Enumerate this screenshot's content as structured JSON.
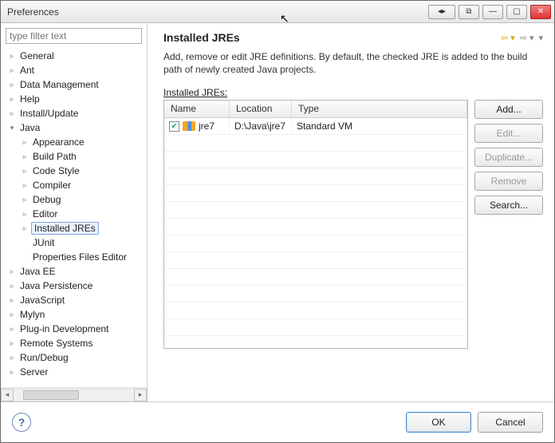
{
  "window": {
    "title": "Preferences"
  },
  "filter": {
    "placeholder": "type filter text"
  },
  "tree": [
    {
      "label": "General",
      "indent": 1,
      "arrow": "right"
    },
    {
      "label": "Ant",
      "indent": 1,
      "arrow": "right"
    },
    {
      "label": "Data Management",
      "indent": 1,
      "arrow": "right"
    },
    {
      "label": "Help",
      "indent": 1,
      "arrow": "right"
    },
    {
      "label": "Install/Update",
      "indent": 1,
      "arrow": "right"
    },
    {
      "label": "Java",
      "indent": 1,
      "arrow": "down",
      "selected": false
    },
    {
      "label": "Appearance",
      "indent": 2,
      "arrow": "right"
    },
    {
      "label": "Build Path",
      "indent": 2,
      "arrow": "right"
    },
    {
      "label": "Code Style",
      "indent": 2,
      "arrow": "right"
    },
    {
      "label": "Compiler",
      "indent": 2,
      "arrow": "right"
    },
    {
      "label": "Debug",
      "indent": 2,
      "arrow": "right"
    },
    {
      "label": "Editor",
      "indent": 2,
      "arrow": "right"
    },
    {
      "label": "Installed JREs",
      "indent": 2,
      "arrow": "right",
      "selected": true
    },
    {
      "label": "JUnit",
      "indent": 2,
      "arrow": "none"
    },
    {
      "label": "Properties Files Editor",
      "indent": 2,
      "arrow": "none"
    },
    {
      "label": "Java EE",
      "indent": 1,
      "arrow": "right"
    },
    {
      "label": "Java Persistence",
      "indent": 1,
      "arrow": "right"
    },
    {
      "label": "JavaScript",
      "indent": 1,
      "arrow": "right"
    },
    {
      "label": "Mylyn",
      "indent": 1,
      "arrow": "right"
    },
    {
      "label": "Plug-in Development",
      "indent": 1,
      "arrow": "right"
    },
    {
      "label": "Remote Systems",
      "indent": 1,
      "arrow": "right"
    },
    {
      "label": "Run/Debug",
      "indent": 1,
      "arrow": "right"
    },
    {
      "label": "Server",
      "indent": 1,
      "arrow": "right"
    }
  ],
  "main": {
    "title": "Installed JREs",
    "description": "Add, remove or edit JRE definitions. By default, the checked JRE is added to the build path of newly created Java projects.",
    "list_label": "Installed JREs:",
    "columns": {
      "c1": "Name",
      "c2": "Location",
      "c3": "Type"
    },
    "rows": [
      {
        "checked": true,
        "name": "jre7",
        "location": "D:\\Java\\jre7",
        "type": "Standard VM"
      }
    ],
    "buttons": {
      "add": "Add...",
      "edit": "Edit...",
      "duplicate": "Duplicate...",
      "remove": "Remove",
      "search": "Search..."
    }
  },
  "footer": {
    "ok": "OK",
    "cancel": "Cancel"
  }
}
